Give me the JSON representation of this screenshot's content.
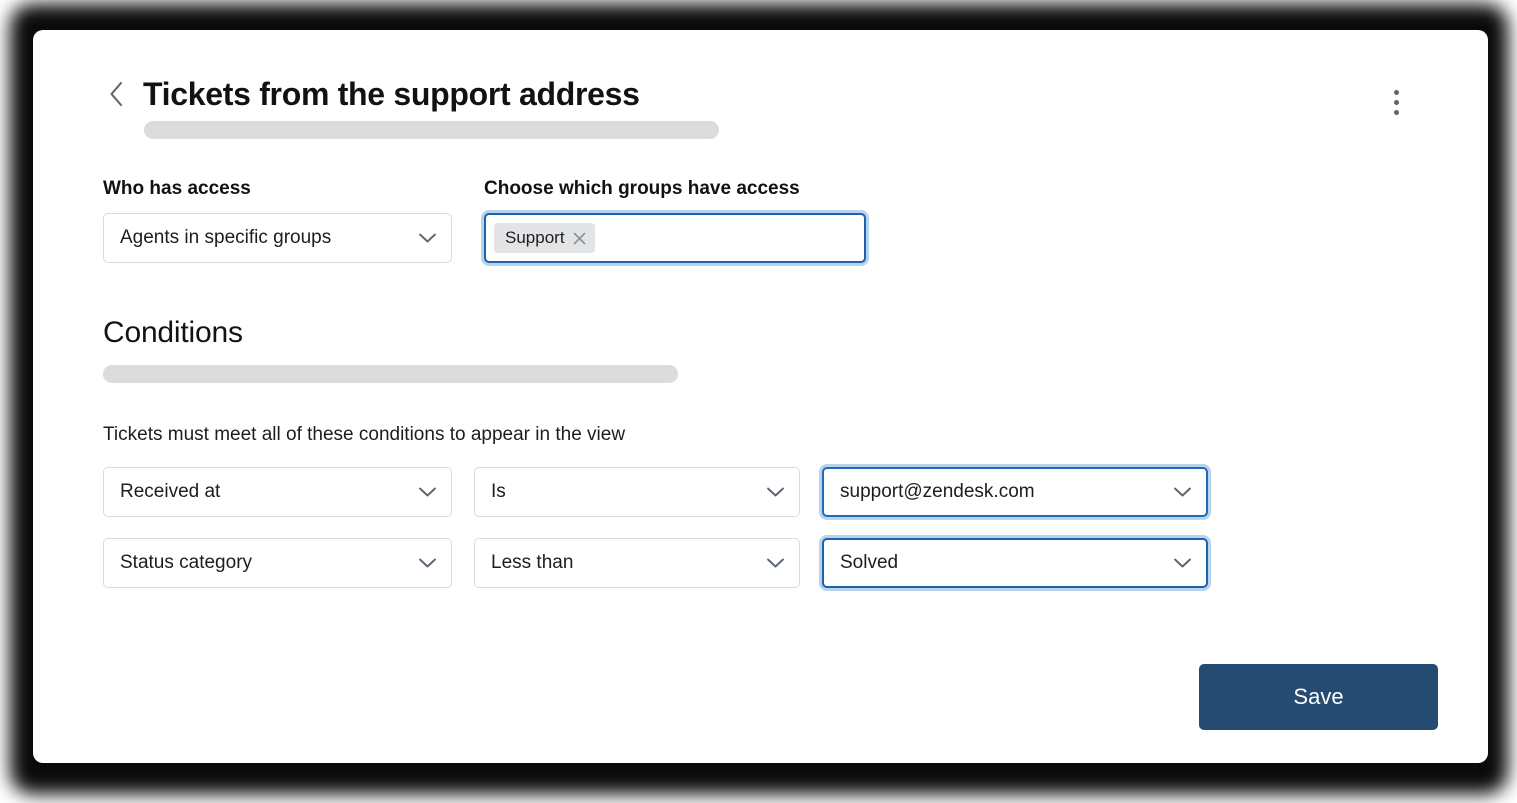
{
  "header": {
    "back_icon": "chevron-left-icon",
    "title": "Tickets from the support address",
    "menu_icon": "kebab-menu-icon"
  },
  "access": {
    "who_label": "Who has access",
    "who_value": "Agents in specific groups",
    "groups_label": "Choose which groups have access",
    "groups_chips": [
      {
        "label": "Support",
        "remove_icon": "close-icon"
      }
    ]
  },
  "conditions": {
    "heading": "Conditions",
    "subtitle": "Tickets must meet all of these conditions to appear in the view",
    "rows": [
      {
        "field": "Received at",
        "operator": "Is",
        "value": "support@zendesk.com"
      },
      {
        "field": "Status category",
        "operator": "Less than",
        "value": "Solved"
      }
    ]
  },
  "footer": {
    "save_label": "Save"
  },
  "colors": {
    "accent_blue": "#1e62a8",
    "focus_ring": "#b8d3ee",
    "save_bg": "#254b72",
    "border": "#d8dcde",
    "skeleton": "#dcdcdd",
    "chip_bg": "#e3e4e6",
    "icon_gray": "#5b6570",
    "text": "#1c1d1f"
  }
}
